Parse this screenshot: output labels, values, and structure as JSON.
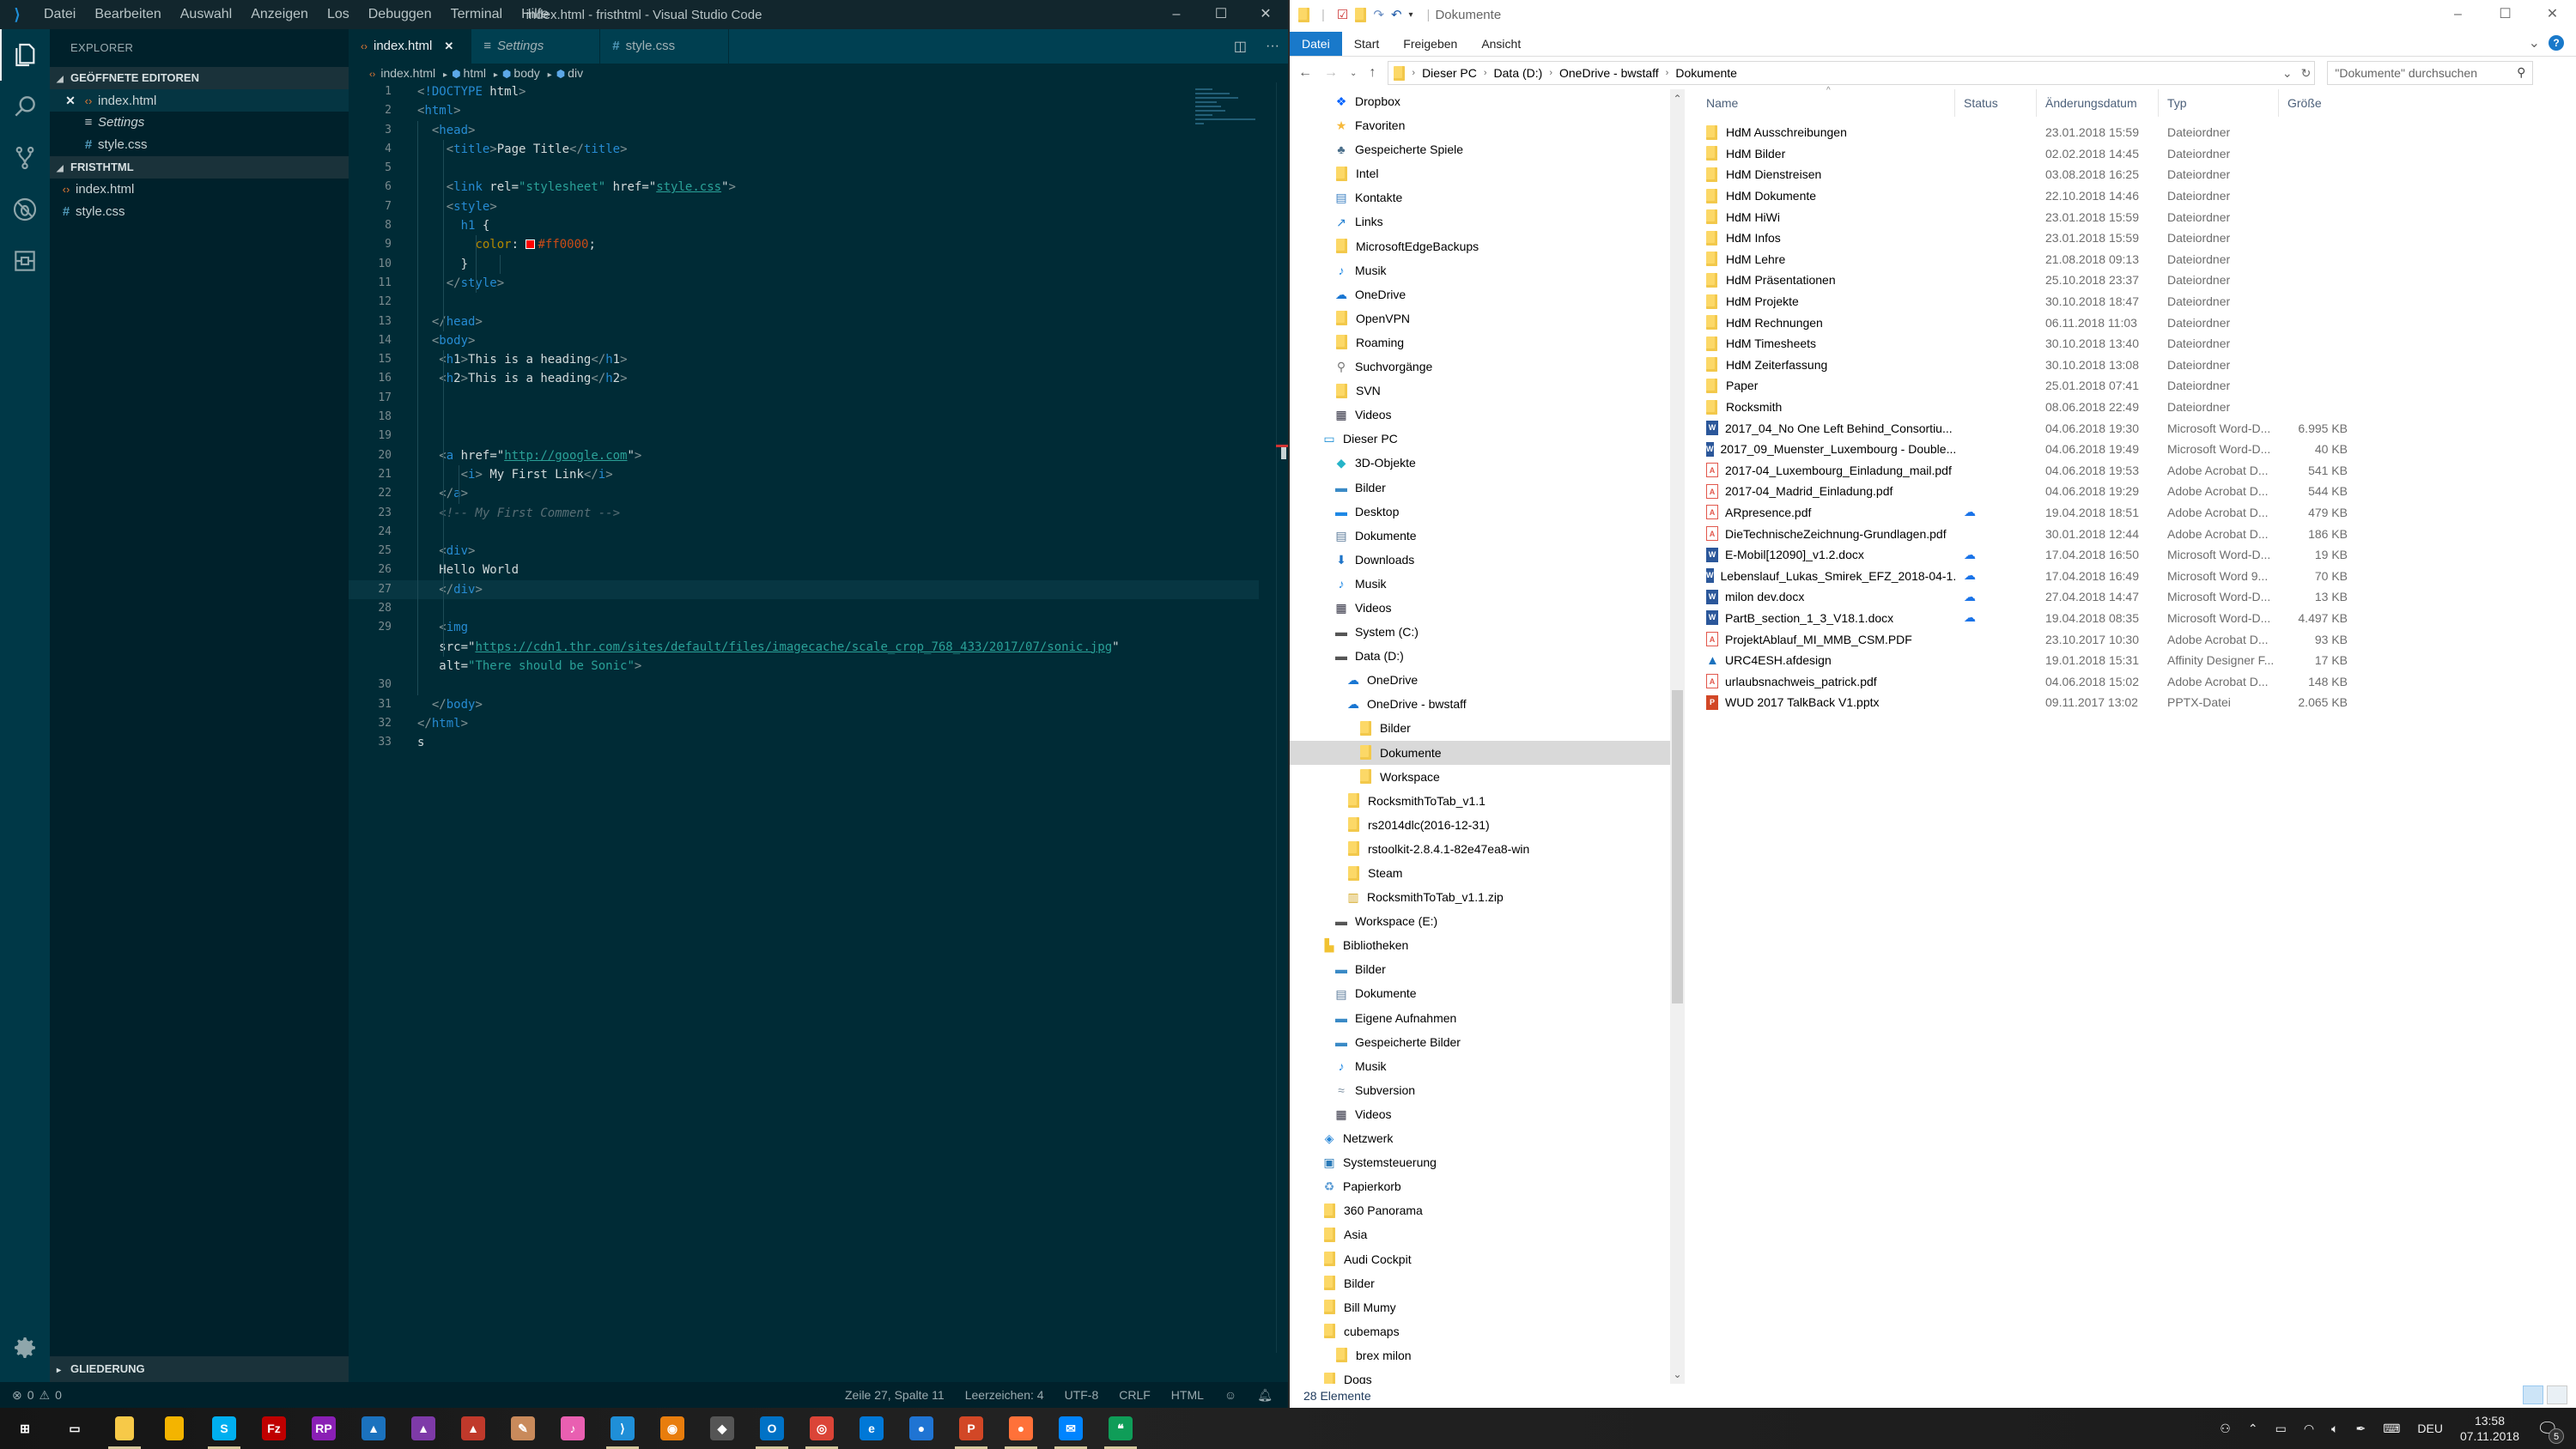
{
  "vscode": {
    "window_title": "index.html - fristhtml - Visual Studio Code",
    "menu": [
      "Datei",
      "Bearbeiten",
      "Auswahl",
      "Anzeigen",
      "Los",
      "Debuggen",
      "Terminal",
      "Hilfe"
    ],
    "window_buttons": {
      "minimize": "–",
      "maximize": "☐",
      "close": "✕"
    },
    "activity_bar": [
      "explorer-icon",
      "search-icon",
      "source-control-icon",
      "debug-icon",
      "extensions-icon"
    ],
    "sidebar": {
      "title": "EXPLORER",
      "open_editors_title": "GEÖFFNETE EDITOREN",
      "open_editors": [
        {
          "name": "index.html",
          "icon": "html-icon",
          "active": true
        },
        {
          "name": "Settings",
          "icon": "settings-icon",
          "italic": true
        },
        {
          "name": "style.css",
          "icon": "css-icon"
        }
      ],
      "folder_title": "FRISTHTML",
      "folder_files": [
        {
          "name": "index.html",
          "icon": "html-icon"
        },
        {
          "name": "style.css",
          "icon": "css-icon"
        }
      ],
      "outline_title": "GLIEDERUNG"
    },
    "tabs": [
      {
        "label": "index.html",
        "icon": "html-icon",
        "active": true
      },
      {
        "label": "Settings",
        "icon": "settings-icon",
        "italic": true
      },
      {
        "label": "style.css",
        "icon": "css-icon"
      }
    ],
    "breadcrumb": [
      "index.html",
      "html",
      "body",
      "div"
    ],
    "code_lines": [
      "<!DOCTYPE html>",
      "<html>",
      "  <head>",
      "    <title>Page Title</title>",
      "",
      "    <link rel=\"stylesheet\" href=\"style.css\">",
      "    <style>",
      "      h1 {",
      "        color: #ff0000;",
      "      }",
      "    </style>",
      "",
      "  </head>",
      "  <body>",
      "   <h1>This is a heading</h1>",
      "   <h2>This is a heading</h2>",
      "",
      "",
      "",
      "   <a href=\"http://google.com\">",
      "      <i> My First Link</i>",
      "   </a>",
      "   <!-- My First Comment -->",
      "",
      "   <div>",
      "   Hello World",
      "   </div>",
      "",
      "   <img",
      "   src=\"https://cdn1.thr.com/sites/default/files/imagecache/scale_crop_768_433/2017/07/sonic.jpg\"",
      "   alt=\"There should be Sonic\">",
      "",
      "  </body>",
      "</html>",
      "s"
    ],
    "line_numbers": [
      "1",
      "2",
      "3",
      "4",
      "5",
      "6",
      "7",
      "8",
      "9",
      "10",
      "11",
      "12",
      "13",
      "14",
      "15",
      "16",
      "17",
      "18",
      "19",
      "20",
      "21",
      "22",
      "23",
      "24",
      "25",
      "26",
      "27",
      "28",
      "29",
      "",
      "",
      "30",
      "31",
      "32",
      "33"
    ],
    "current_line": 27,
    "status": {
      "errors": "0",
      "warnings": "0",
      "position": "Zeile 27, Spalte 11",
      "indent": "Leerzeichen: 4",
      "encoding": "UTF-8",
      "eol": "CRLF",
      "language": "HTML"
    }
  },
  "file_explorer": {
    "window_title": "Dokumente",
    "ribbon_tabs": [
      "Datei",
      "Start",
      "Freigeben",
      "Ansicht"
    ],
    "address": [
      "Dieser PC",
      "Data (D:)",
      "OneDrive - bwstaff",
      "Dokumente"
    ],
    "search_placeholder": "\"Dokumente\" durchsuchen",
    "nav_items": [
      {
        "label": "Dropbox",
        "icon": "dropbox-icon",
        "indent": 1
      },
      {
        "label": "Favoriten",
        "icon": "star-icon",
        "indent": 1
      },
      {
        "label": "Gespeicherte Spiele",
        "icon": "games-icon",
        "indent": 1
      },
      {
        "label": "Intel",
        "icon": "folder-icon",
        "indent": 1
      },
      {
        "label": "Kontakte",
        "icon": "contacts-icon",
        "indent": 1
      },
      {
        "label": "Links",
        "icon": "link-icon",
        "indent": 1
      },
      {
        "label": "MicrosoftEdgeBackups",
        "icon": "folder-icon",
        "indent": 1
      },
      {
        "label": "Musik",
        "icon": "music-icon",
        "indent": 1
      },
      {
        "label": "OneDrive",
        "icon": "cloud-icon",
        "indent": 1
      },
      {
        "label": "OpenVPN",
        "icon": "folder-icon",
        "indent": 1
      },
      {
        "label": "Roaming",
        "icon": "folder-icon",
        "indent": 1
      },
      {
        "label": "Suchvorgänge",
        "icon": "search-icon",
        "indent": 1
      },
      {
        "label": "SVN",
        "icon": "folder-icon",
        "indent": 1
      },
      {
        "label": "Videos",
        "icon": "video-icon",
        "indent": 1
      },
      {
        "label": "Dieser PC",
        "icon": "pc-icon",
        "indent": 0
      },
      {
        "label": "3D-Objekte",
        "icon": "cube-icon",
        "indent": 1
      },
      {
        "label": "Bilder",
        "icon": "pictures-icon",
        "indent": 1
      },
      {
        "label": "Desktop",
        "icon": "desktop-icon",
        "indent": 1
      },
      {
        "label": "Dokumente",
        "icon": "documents-icon",
        "indent": 1
      },
      {
        "label": "Downloads",
        "icon": "download-icon",
        "indent": 1
      },
      {
        "label": "Musik",
        "icon": "music-icon",
        "indent": 1
      },
      {
        "label": "Videos",
        "icon": "video-icon",
        "indent": 1
      },
      {
        "label": "System (C:)",
        "icon": "drive-icon",
        "indent": 1
      },
      {
        "label": "Data (D:)",
        "icon": "drive-icon",
        "indent": 1
      },
      {
        "label": "OneDrive",
        "icon": "cloud-icon",
        "indent": 2
      },
      {
        "label": "OneDrive - bwstaff",
        "icon": "cloud-icon",
        "indent": 2
      },
      {
        "label": "Bilder",
        "icon": "folder-icon",
        "indent": 3
      },
      {
        "label": "Dokumente",
        "icon": "folder-icon",
        "indent": 3,
        "selected": true
      },
      {
        "label": "Workspace",
        "icon": "folder-icon",
        "indent": 3
      },
      {
        "label": "RocksmithToTab_v1.1",
        "icon": "folder-icon",
        "indent": 2
      },
      {
        "label": "rs2014dlc(2016-12-31)",
        "icon": "folder-icon",
        "indent": 2
      },
      {
        "label": "rstoolkit-2.8.4.1-82e47ea8-win",
        "icon": "folder-icon",
        "indent": 2
      },
      {
        "label": "Steam",
        "icon": "folder-icon",
        "indent": 2
      },
      {
        "label": "RocksmithToTab_v1.1.zip",
        "icon": "zip-icon",
        "indent": 2
      },
      {
        "label": "Workspace (E:)",
        "icon": "drive-icon",
        "indent": 1
      },
      {
        "label": "Bibliotheken",
        "icon": "library-icon",
        "indent": 0
      },
      {
        "label": "Bilder",
        "icon": "pictures-icon",
        "indent": 1
      },
      {
        "label": "Dokumente",
        "icon": "documents-icon",
        "indent": 1
      },
      {
        "label": "Eigene Aufnahmen",
        "icon": "pictures-icon",
        "indent": 1
      },
      {
        "label": "Gespeicherte Bilder",
        "icon": "pictures-icon",
        "indent": 1
      },
      {
        "label": "Musik",
        "icon": "music-icon",
        "indent": 1
      },
      {
        "label": "Subversion",
        "icon": "subversion-icon",
        "indent": 1
      },
      {
        "label": "Videos",
        "icon": "video-icon",
        "indent": 1
      },
      {
        "label": "Netzwerk",
        "icon": "network-icon",
        "indent": 0
      },
      {
        "label": "Systemsteuerung",
        "icon": "control-panel-icon",
        "indent": 0
      },
      {
        "label": "Papierkorb",
        "icon": "recycle-bin-icon",
        "indent": 0
      },
      {
        "label": "360 Panorama",
        "icon": "folder-icon",
        "indent": 0
      },
      {
        "label": "Asia",
        "icon": "folder-icon",
        "indent": 0
      },
      {
        "label": "Audi Cockpit",
        "icon": "folder-icon",
        "indent": 0
      },
      {
        "label": "Bilder",
        "icon": "folder-icon",
        "indent": 0
      },
      {
        "label": "Bill Mumy",
        "icon": "folder-icon",
        "indent": 0
      },
      {
        "label": "cubemaps",
        "icon": "folder-icon",
        "indent": 0
      },
      {
        "label": "brex milon",
        "icon": "folder-icon",
        "indent": 1
      },
      {
        "label": "Dogs",
        "icon": "folder-icon",
        "indent": 0
      }
    ],
    "columns": [
      "Name",
      "Status",
      "Änderungsdatum",
      "Typ",
      "Größe"
    ],
    "files": [
      {
        "name": "HdM Ausschreibungen",
        "status": "",
        "date": "23.01.2018 15:59",
        "type": "Dateiordner",
        "size": "",
        "icon": "folder"
      },
      {
        "name": "HdM Bilder",
        "status": "",
        "date": "02.02.2018 14:45",
        "type": "Dateiordner",
        "size": "",
        "icon": "folder"
      },
      {
        "name": "HdM Dienstreisen",
        "status": "",
        "date": "03.08.2018 16:25",
        "type": "Dateiordner",
        "size": "",
        "icon": "folder"
      },
      {
        "name": "HdM Dokumente",
        "status": "",
        "date": "22.10.2018 14:46",
        "type": "Dateiordner",
        "size": "",
        "icon": "folder"
      },
      {
        "name": "HdM HiWi",
        "status": "",
        "date": "23.01.2018 15:59",
        "type": "Dateiordner",
        "size": "",
        "icon": "folder"
      },
      {
        "name": "HdM Infos",
        "status": "",
        "date": "23.01.2018 15:59",
        "type": "Dateiordner",
        "size": "",
        "icon": "folder"
      },
      {
        "name": "HdM Lehre",
        "status": "",
        "date": "21.08.2018 09:13",
        "type": "Dateiordner",
        "size": "",
        "icon": "folder"
      },
      {
        "name": "HdM Präsentationen",
        "status": "",
        "date": "25.10.2018 23:37",
        "type": "Dateiordner",
        "size": "",
        "icon": "folder"
      },
      {
        "name": "HdM Projekte",
        "status": "",
        "date": "30.10.2018 18:47",
        "type": "Dateiordner",
        "size": "",
        "icon": "folder"
      },
      {
        "name": "HdM Rechnungen",
        "status": "",
        "date": "06.11.2018 11:03",
        "type": "Dateiordner",
        "size": "",
        "icon": "folder"
      },
      {
        "name": "HdM Timesheets",
        "status": "",
        "date": "30.10.2018 13:40",
        "type": "Dateiordner",
        "size": "",
        "icon": "folder"
      },
      {
        "name": "HdM Zeiterfassung",
        "status": "",
        "date": "30.10.2018 13:08",
        "type": "Dateiordner",
        "size": "",
        "icon": "folder"
      },
      {
        "name": "Paper",
        "status": "",
        "date": "25.01.2018 07:41",
        "type": "Dateiordner",
        "size": "",
        "icon": "folder"
      },
      {
        "name": "Rocksmith",
        "status": "",
        "date": "08.06.2018 22:49",
        "type": "Dateiordner",
        "size": "",
        "icon": "folder"
      },
      {
        "name": "2017_04_No One Left Behind_Consortiu...",
        "status": "",
        "date": "04.06.2018 19:30",
        "type": "Microsoft Word-D...",
        "size": "6.995 KB",
        "icon": "word"
      },
      {
        "name": "2017_09_Muenster_Luxembourg - Double...",
        "status": "",
        "date": "04.06.2018 19:49",
        "type": "Microsoft Word-D...",
        "size": "40 KB",
        "icon": "word"
      },
      {
        "name": "2017-04_Luxembourg_Einladung_mail.pdf",
        "status": "",
        "date": "04.06.2018 19:53",
        "type": "Adobe Acrobat D...",
        "size": "541 KB",
        "icon": "pdf"
      },
      {
        "name": "2017-04_Madrid_Einladung.pdf",
        "status": "",
        "date": "04.06.2018 19:29",
        "type": "Adobe Acrobat D...",
        "size": "544 KB",
        "icon": "pdf"
      },
      {
        "name": "ARpresence.pdf",
        "status": "cloud",
        "date": "19.04.2018 18:51",
        "type": "Adobe Acrobat D...",
        "size": "479 KB",
        "icon": "pdf"
      },
      {
        "name": "DieTechnischeZeichnung-Grundlagen.pdf",
        "status": "",
        "date": "30.01.2018 12:44",
        "type": "Adobe Acrobat D...",
        "size": "186 KB",
        "icon": "pdf"
      },
      {
        "name": "E-Mobil[12090]_v1.2.docx",
        "status": "cloud",
        "date": "17.04.2018 16:50",
        "type": "Microsoft Word-D...",
        "size": "19 KB",
        "icon": "word"
      },
      {
        "name": "Lebenslauf_Lukas_Smirek_EFZ_2018-04-1...",
        "status": "cloud",
        "date": "17.04.2018 16:49",
        "type": "Microsoft Word 9...",
        "size": "70 KB",
        "icon": "word"
      },
      {
        "name": "milon dev.docx",
        "status": "cloud",
        "date": "27.04.2018 14:47",
        "type": "Microsoft Word-D...",
        "size": "13 KB",
        "icon": "word"
      },
      {
        "name": "PartB_section_1_3_V18.1.docx",
        "status": "cloud",
        "date": "19.04.2018 08:35",
        "type": "Microsoft Word-D...",
        "size": "4.497 KB",
        "icon": "word"
      },
      {
        "name": "ProjektAblauf_MI_MMB_CSM.PDF",
        "status": "",
        "date": "23.10.2017 10:30",
        "type": "Adobe Acrobat D...",
        "size": "93 KB",
        "icon": "pdf"
      },
      {
        "name": "URC4ESH.afdesign",
        "status": "",
        "date": "19.01.2018 15:31",
        "type": "Affinity Designer F...",
        "size": "17 KB",
        "icon": "af"
      },
      {
        "name": "urlaubsnachweis_patrick.pdf",
        "status": "",
        "date": "04.06.2018 15:02",
        "type": "Adobe Acrobat D...",
        "size": "148 KB",
        "icon": "pdf"
      },
      {
        "name": "WUD 2017 TalkBack V1.pptx",
        "status": "",
        "date": "09.11.2017 13:02",
        "type": "PPTX-Datei",
        "size": "2.065 KB",
        "icon": "ppt"
      }
    ],
    "status_text": "28 Elemente"
  },
  "taskbar": {
    "apps": [
      {
        "name": "start-button",
        "glyph": "⊞",
        "color": "transparent"
      },
      {
        "name": "task-view",
        "glyph": "▭",
        "color": "transparent"
      },
      {
        "name": "file-explorer",
        "glyph": "",
        "color": "#f7c948",
        "running": true
      },
      {
        "name": "keep-notes",
        "glyph": "",
        "color": "#f4b400"
      },
      {
        "name": "skype",
        "glyph": "S",
        "color": "#00aff0",
        "running": true
      },
      {
        "name": "filezilla",
        "glyph": "Fz",
        "color": "#bf0000"
      },
      {
        "name": "axure-rp",
        "glyph": "RP",
        "color": "#8a1fb5"
      },
      {
        "name": "affinity-designer",
        "glyph": "▲",
        "color": "#1b72be"
      },
      {
        "name": "affinity-photo",
        "glyph": "▲",
        "color": "#7e3aa8"
      },
      {
        "name": "affinity-publisher",
        "glyph": "▲",
        "color": "#c0392b"
      },
      {
        "name": "pencil",
        "glyph": "✎",
        "color": "#c98a5b"
      },
      {
        "name": "itunes",
        "glyph": "♪",
        "color": "#e95fb1"
      },
      {
        "name": "vscode",
        "glyph": "⟩",
        "color": "#1f8fd8",
        "running": true
      },
      {
        "name": "blender",
        "glyph": "◉",
        "color": "#e87d0d"
      },
      {
        "name": "unity",
        "glyph": "◆",
        "color": "#555"
      },
      {
        "name": "outlook",
        "glyph": "O",
        "color": "#0072c6",
        "running": true
      },
      {
        "name": "chrome",
        "glyph": "◎",
        "color": "#db4437",
        "running": true
      },
      {
        "name": "edge",
        "glyph": "e",
        "color": "#0078d7"
      },
      {
        "name": "firefox-dev",
        "glyph": "●",
        "color": "#1f74d3"
      },
      {
        "name": "powerpoint",
        "glyph": "P",
        "color": "#d24726",
        "running": true
      },
      {
        "name": "firefox",
        "glyph": "●",
        "color": "#ff7139",
        "running": true
      },
      {
        "name": "messenger",
        "glyph": "✉",
        "color": "#0084ff",
        "running": true
      },
      {
        "name": "hangouts",
        "glyph": "❝",
        "color": "#0f9d58",
        "running": true
      }
    ],
    "tray": {
      "language": "DEU",
      "time": "13:58",
      "date": "07.11.2018",
      "notifications": "5"
    }
  }
}
